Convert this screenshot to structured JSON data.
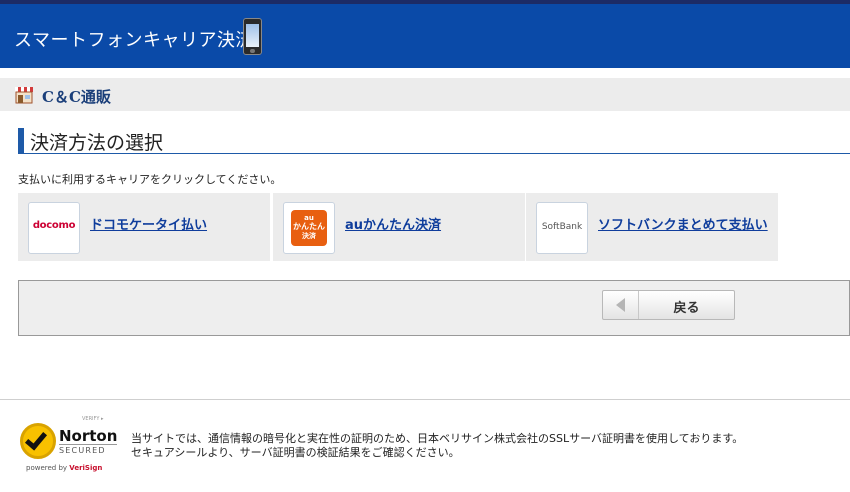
{
  "header": {
    "title": "スマートフォンキャリア決済"
  },
  "shop": {
    "name": "C＆C通販"
  },
  "section": {
    "title": "決済方法の選択"
  },
  "instruction": "支払いに利用するキャリアをクリックしてください。",
  "carriers": [
    {
      "logo_text": "docomo",
      "label": "ドコモケータイ払い"
    },
    {
      "logo_lines": [
        "au",
        "かんたん",
        "決済"
      ],
      "label": "auかんたん決済"
    },
    {
      "logo_text": "SoftBank",
      "label": "ソフトバンクまとめて支払い"
    }
  ],
  "back_button": {
    "label": "戻る"
  },
  "norton": {
    "verify": "VERIFY ▸",
    "brand": "Norton",
    "secured": "SECURED",
    "powered_by": "powered by",
    "verisign": "VeriSign"
  },
  "footer": {
    "line1": "当サイトでは、通信情報の暗号化と実在性の証明のため、日本ベリサイン株式会社のSSLサーバ証明書を使用しております。",
    "line2": "セキュアシールより、サーバ証明書の検証結果をご確認ください。"
  },
  "colors": {
    "header": "#0a4aa8",
    "link": "#0f3d9c",
    "accent": "#1e5aa8",
    "docomo": "#cc0033",
    "au": "#e85f10"
  }
}
